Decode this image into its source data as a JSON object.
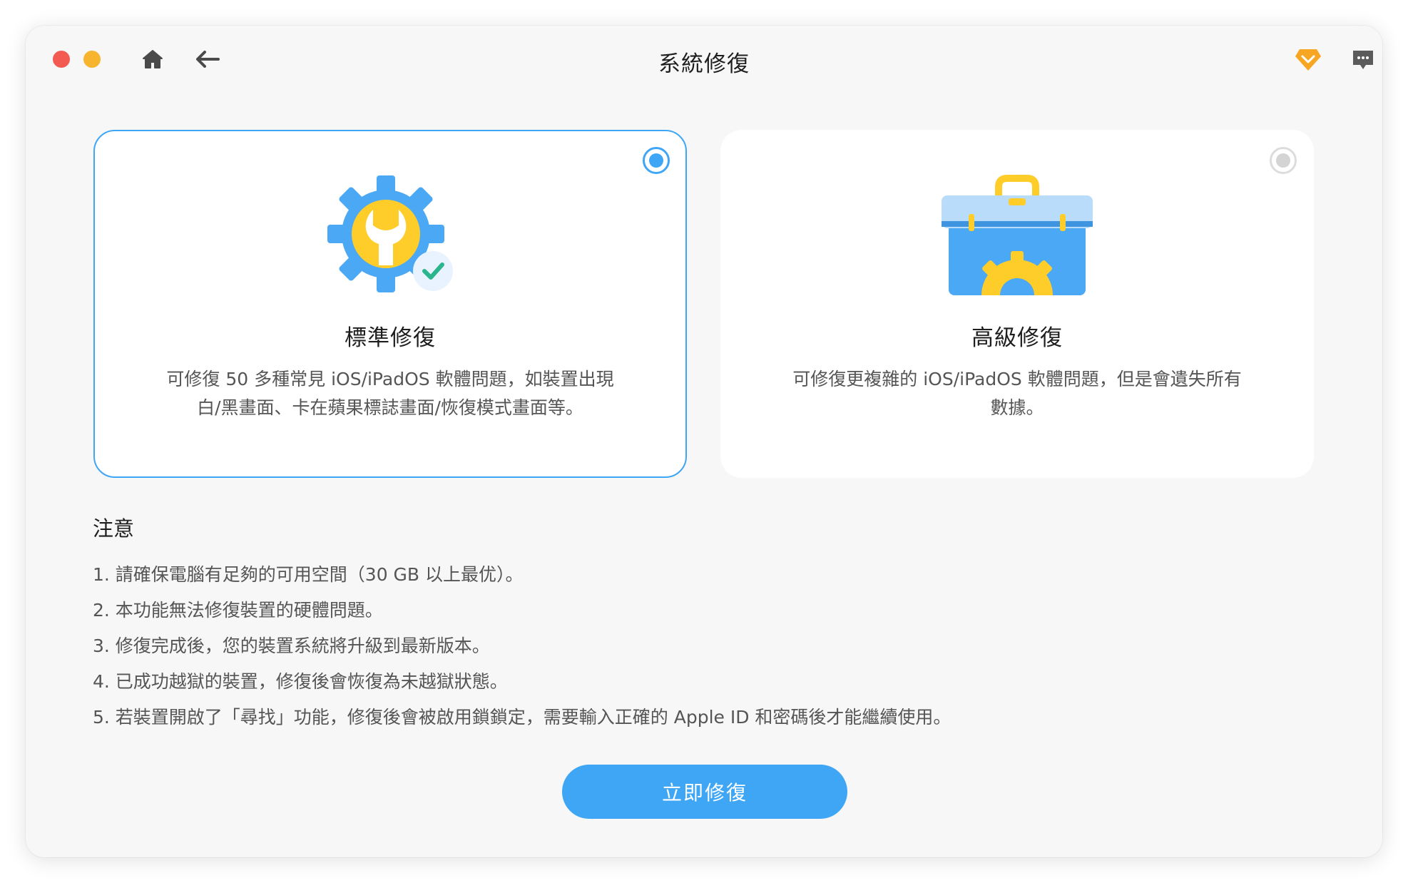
{
  "window": {
    "title": "系統修復"
  },
  "toolbar": {
    "icons": [
      "home-icon",
      "back-arrow-icon",
      "vip-diamond-icon",
      "chat-icon"
    ]
  },
  "modes": [
    {
      "id": "standard",
      "title": "標準修復",
      "description": "可修復 50 多種常見 iOS/iPadOS 軟體問題，如裝置出現白/黑畫面、卡在蘋果標誌畫面/恢復模式畫面等。",
      "selected": true,
      "icon": "gear-wrench-icon"
    },
    {
      "id": "advanced",
      "title": "高級修復",
      "description": "可修復更複雜的 iOS/iPadOS 軟體問題，但是會遺失所有數據。",
      "selected": false,
      "icon": "toolbox-icon"
    }
  ],
  "notes": {
    "title": "注意",
    "items": [
      "1. 請確保電腦有足夠的可用空間（30 GB 以上最优）。",
      "2. 本功能無法修復裝置的硬體問題。",
      "3. 修復完成後，您的裝置系統將升級到最新版本。",
      "4. 已成功越獄的裝置，修復後會恢復為未越獄狀態。",
      "5. 若裝置開啟了「尋找」功能，修復後會被啟用鎖鎖定，需要輸入正確的 Apple ID 和密碼後才能繼續使用。"
    ]
  },
  "actions": {
    "repair_label": "立即修復"
  },
  "colors": {
    "accent": "#3ea6f5",
    "close": "#f25a52",
    "minimize": "#f6b42f",
    "vip": "#f7a623"
  }
}
